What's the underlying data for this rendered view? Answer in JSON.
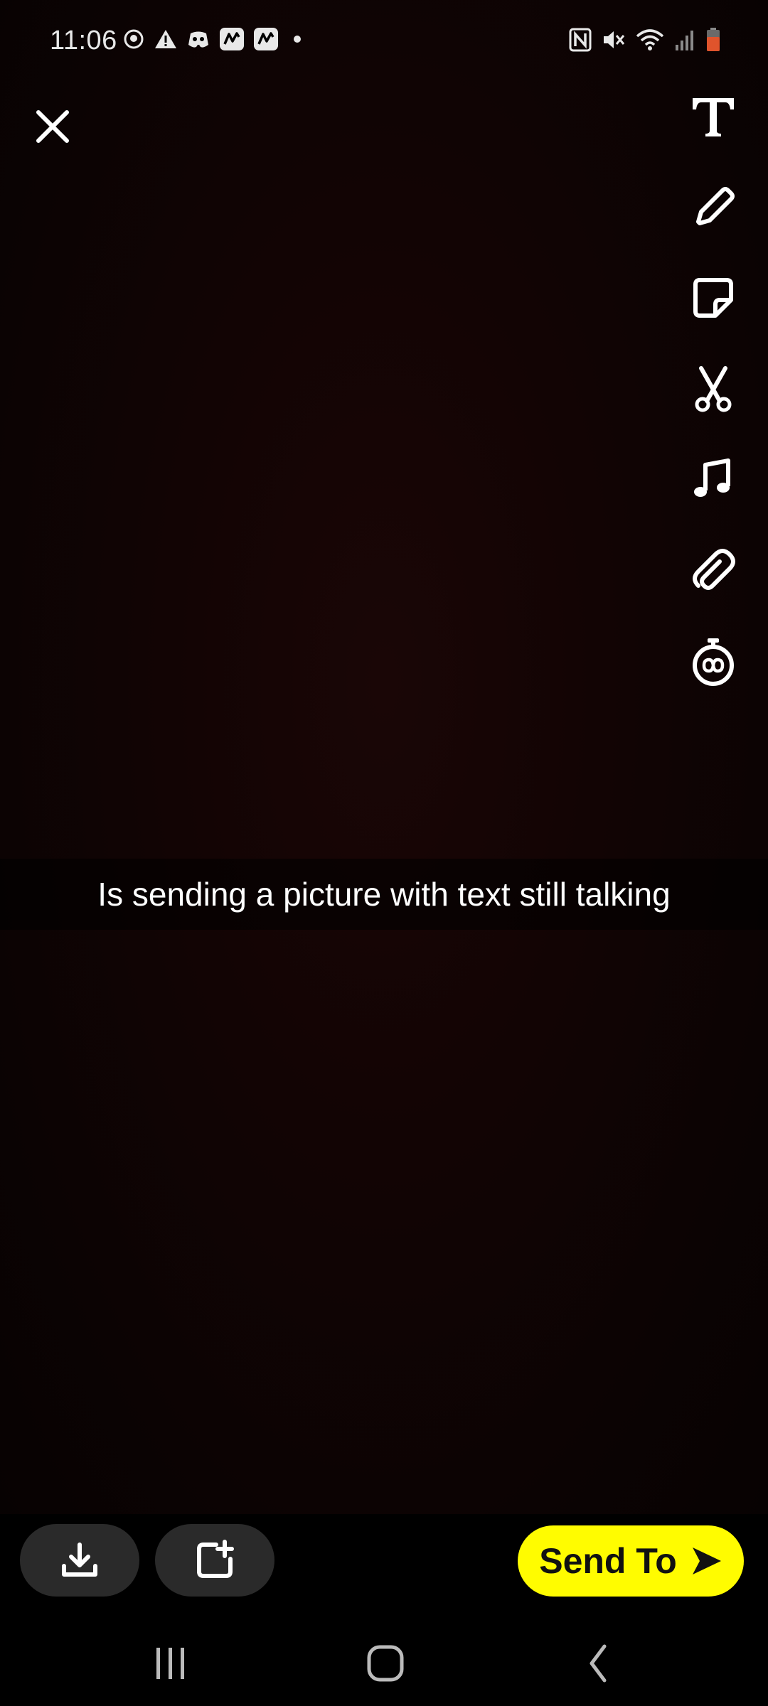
{
  "status_bar": {
    "time": "11:06",
    "left_icons": [
      "snapchat-status-icon",
      "warning-icon",
      "discord-icon",
      "app-icon",
      "app-icon",
      "dot-icon"
    ],
    "right_icons": [
      "nfc-icon",
      "mute-icon",
      "wifi-icon",
      "signal-icon",
      "battery-icon"
    ]
  },
  "editor": {
    "close_icon": "close-icon",
    "tools": [
      "text-icon",
      "pencil-icon",
      "sticker-icon",
      "scissors-icon",
      "music-icon",
      "paperclip-icon",
      "timer-icon"
    ]
  },
  "caption": {
    "text": "Is sending a picture with text still talking"
  },
  "bottom_bar": {
    "save_icon": "download-icon",
    "story_icon": "add-story-icon",
    "send_label": "Send To",
    "send_color": "#FFFC00"
  },
  "nav_bar": {
    "buttons": [
      "recents-icon",
      "home-icon",
      "back-icon"
    ]
  }
}
